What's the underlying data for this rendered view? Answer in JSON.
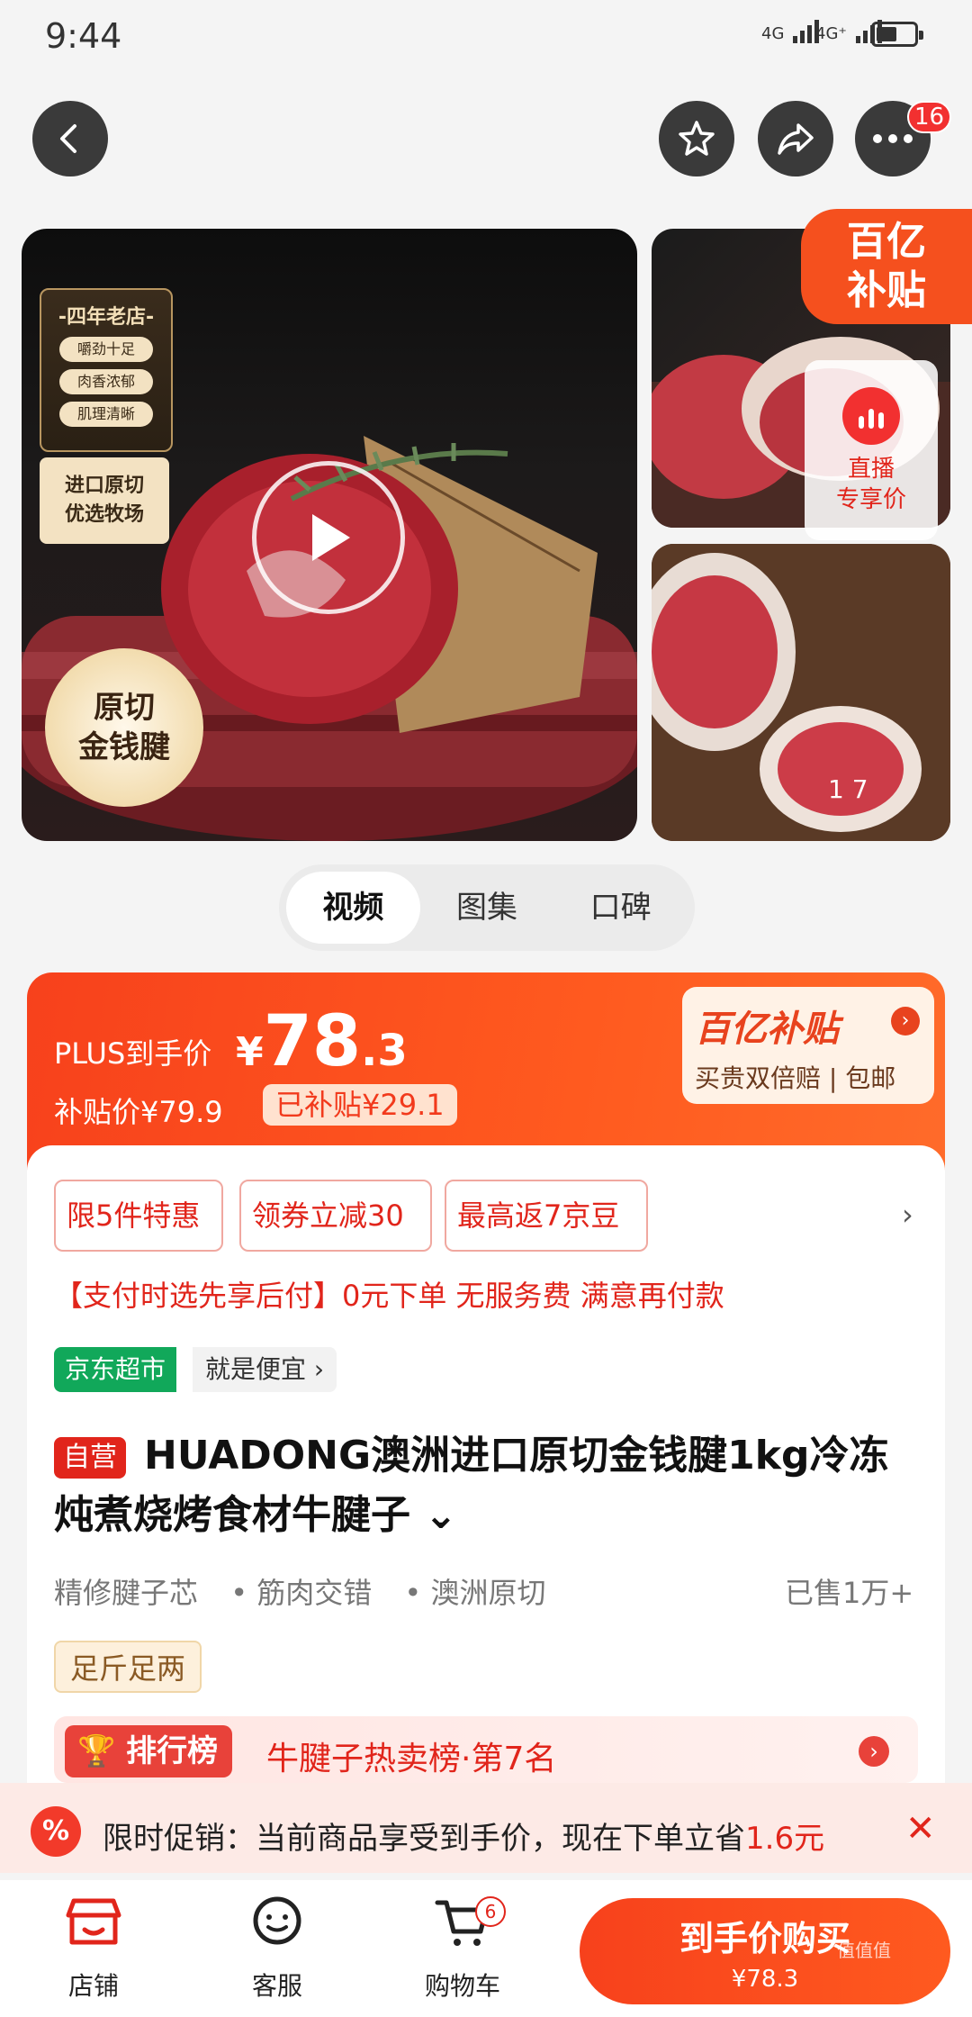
{
  "status": {
    "time": "9:44",
    "net1": "4G",
    "net2": "4G⁺"
  },
  "header": {
    "cart_count": "16"
  },
  "gallery": {
    "store_badge": {
      "title": "-四年老店-",
      "pills": [
        "嚼劲十足",
        "肉香浓郁",
        "肌理清晰"
      ]
    },
    "import_tag": [
      "进口原切",
      "优选牧场"
    ],
    "seal": [
      "原切",
      "金钱腱"
    ],
    "subsidy_label": [
      "百亿",
      "补贴"
    ],
    "live": [
      "直播",
      "专享价"
    ],
    "counter": "1  7"
  },
  "tabs": [
    "视频",
    "图集",
    "口碑"
  ],
  "price": {
    "plus_label": "PLUS到手价",
    "currency": "¥",
    "integer": "78",
    "decimal": ".3",
    "subsidy_price": "补贴价¥79.9",
    "saved": "已补贴¥29.1",
    "panel_title": "百亿补贴",
    "panel_sub": "买贵双倍赔 | 包邮"
  },
  "coupons": [
    "限5件特惠",
    "领券立减30",
    "最高返7京豆"
  ],
  "pay_note": "【支付时选先享后付】0元下单 无服务费 满意再付款",
  "jd": {
    "tag": "京东超市",
    "slogan": "就是便宜 ›"
  },
  "product": {
    "self_tag": "自营",
    "title": "HUADONG澳洲进口原切金钱腱1kg冷冻炖煮烧烤食材牛腱子 ⌄",
    "features": [
      "精修腱子芯",
      "• 筋肉交错",
      "• 澳洲原切"
    ],
    "sold": "已售1万+",
    "weight_tag": "足斤足两"
  },
  "rank": {
    "tag": "排行榜",
    "text": "牛腱子热卖榜·第7名"
  },
  "promo": {
    "prefix": "限时促销：当前商品享受到手价，现在下单立省",
    "amount": "1.6元"
  },
  "bottom": {
    "store": "店铺",
    "service": "客服",
    "cart": "购物车",
    "cart_badge": "6",
    "buy_label": "到手价购买",
    "buy_price": "¥78.3"
  },
  "watermark": "值值值",
  "colors": {
    "accent": "#f23a1c",
    "brand_red": "#e1251b",
    "jd_green": "#11a85a"
  }
}
